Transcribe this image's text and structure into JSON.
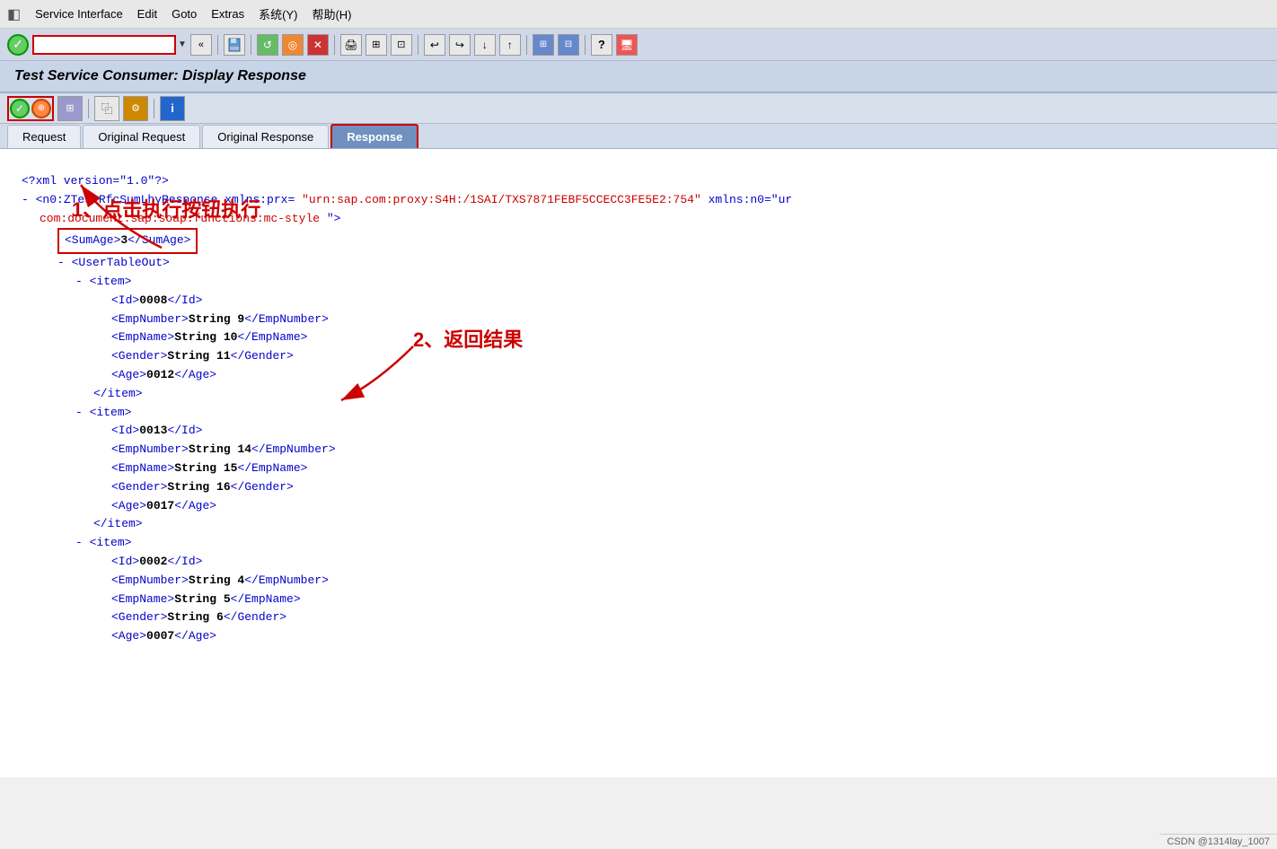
{
  "app": {
    "icon": "◧",
    "title": "Service Interface"
  },
  "menu": {
    "items": [
      {
        "label": "Service Interface",
        "underline": ""
      },
      {
        "label": "Edit",
        "underline": "E"
      },
      {
        "label": "Goto",
        "underline": "G"
      },
      {
        "label": "Extras",
        "underline": "E"
      },
      {
        "label": "系统(Y)",
        "underline": ""
      },
      {
        "label": "帮助(H)",
        "underline": ""
      }
    ]
  },
  "page_title": "Test Service Consumer: Display Response",
  "tabs": [
    {
      "id": "request",
      "label": "Request",
      "active": false
    },
    {
      "id": "original-request",
      "label": "Original Request",
      "active": false
    },
    {
      "id": "original-response",
      "label": "Original Response",
      "active": false
    },
    {
      "id": "response",
      "label": "Response",
      "active": true
    }
  ],
  "annotations": {
    "step1": "1、点击执行按钮执行",
    "step2": "2、返回结果"
  },
  "xml": {
    "pi": "<?xml version=\"1.0\"?>",
    "root_open": "- <n0:ZTestRfcSumLhyResponse xmlns:prx=",
    "root_attr_prx": "\"urn:sap.com:proxy:S4H:/1SAI/TXS7871FEBF5CCECC3FE5E2:754\"",
    "root_attr_n0_partial": " xmlns:n0=\"ur",
    "root_attr_cont": "com:document:sap:soap:functions:mc-style\">",
    "sumage_line": "<SumAge>3</SumAge>",
    "user_table_open": "- <UserTableOut>",
    "items": [
      {
        "id": "0008",
        "emp_number": "String 9",
        "emp_name": "String 10",
        "gender": "String 11",
        "age": "0012"
      },
      {
        "id": "0013",
        "emp_number": "String 14",
        "emp_name": "String 15",
        "gender": "String 16",
        "age": "0017"
      },
      {
        "id": "0002",
        "emp_number": "String 4",
        "emp_name": "String 5",
        "gender": "String 6",
        "age": "0007"
      }
    ]
  },
  "status_bar": {
    "text": "CSDN @1314lay_1007"
  },
  "toolbar": {
    "input_value": "",
    "input_placeholder": ""
  }
}
